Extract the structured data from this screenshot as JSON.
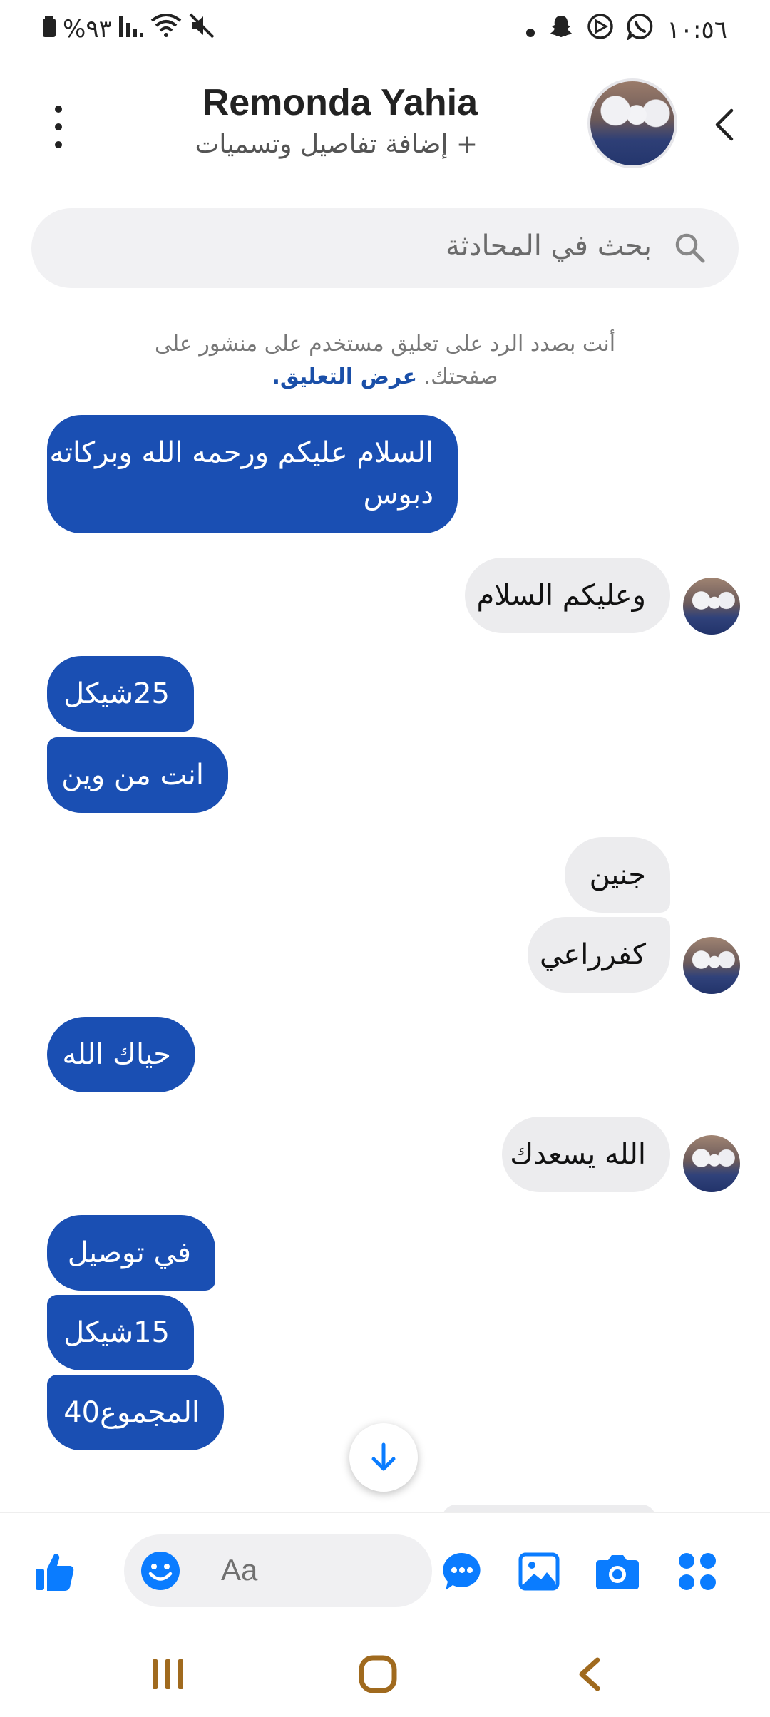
{
  "status_bar": {
    "battery": "%٩٣",
    "time": "١٠:٥٦"
  },
  "header": {
    "contact_name": "Remonda Yahia",
    "subtitle": "+ إضافة تفاصيل وتسميات"
  },
  "search": {
    "placeholder": "بحث في المحادثة"
  },
  "notice": {
    "text": "أنت بصدد الرد على تعليق مستخدم على منشور على صفحتك.",
    "link": "عرض التعليق."
  },
  "messages": [
    {
      "from": "me",
      "line1": "السلام عليكم ورحمه الله وبركاته",
      "line2": "دبوس"
    },
    {
      "from": "them",
      "text": "وعليكم السلام"
    },
    {
      "from": "me",
      "text": "25شيكل"
    },
    {
      "from": "me",
      "text": "انت من وين"
    },
    {
      "from": "them",
      "text": "جنين"
    },
    {
      "from": "them",
      "text": "كفرراعي"
    },
    {
      "from": "me",
      "text": "حياك الله"
    },
    {
      "from": "them",
      "text": "الله يسعدك"
    },
    {
      "from": "me",
      "text": "في توصيل"
    },
    {
      "from": "me",
      "text": "15شيكل"
    },
    {
      "from": "me",
      "text": "المجموع40"
    }
  ],
  "composer": {
    "placeholder": "Aa"
  },
  "colors": {
    "outgoing_bubble": "#1a4fb3",
    "incoming_bubble": "#ececee",
    "accent": "#0a7cff"
  },
  "icons": {
    "status_left": [
      "battery-icon",
      "signal-icon",
      "wifi-icon",
      "mute-icon"
    ],
    "status_right": [
      "dot-icon",
      "snapchat-icon",
      "app-icon",
      "whatsapp-icon"
    ],
    "composer": [
      "apps-icon",
      "camera-icon",
      "gallery-icon",
      "chat-bubble-icon",
      "emoji-icon",
      "like-icon"
    ]
  }
}
